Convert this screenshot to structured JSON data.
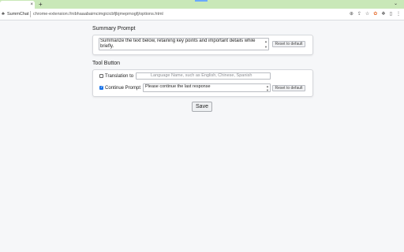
{
  "browser": {
    "tab_close": "×",
    "new_tab": "+",
    "window_chevron": "⌄",
    "site_icon": "♣",
    "site_name": "SummChat",
    "url": "chrome-extension://nibhaaabaimcimgicicbfjbjmepmogfj/options.html",
    "tools": [
      "zoom-icon",
      "share-icon",
      "star-icon",
      "extension-icon",
      "puzzle-icon",
      "sidebar-icon",
      "menu-icon"
    ],
    "tool_glyphs": [
      "⊕",
      "⇪",
      "☆",
      "✿",
      "❖",
      "▯",
      "⋮"
    ]
  },
  "summary": {
    "title": "Summary Prompt",
    "prompt": "Summarize the text below, retaining key points and important details while briefly.",
    "reset_label": "Reset to default"
  },
  "tool_button": {
    "title": "Tool Button",
    "translation": {
      "label": "Translation to",
      "checked": false,
      "placeholder": "Language Name, such as English, Chinese, Spanish"
    },
    "continue": {
      "label": "Continue Prompt",
      "checked": true,
      "value": "Please continue the last response",
      "reset_label": "Reset to default"
    }
  },
  "save_label": "Save"
}
